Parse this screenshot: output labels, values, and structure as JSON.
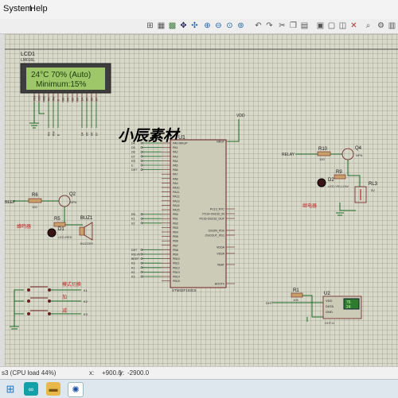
{
  "menu": {
    "items": [
      "System",
      "Help"
    ]
  },
  "toolbar": {
    "buttons": [
      "select-icon",
      "component-icon",
      "junction-icon",
      "pan-icon",
      "zoom-in-icon",
      "zoom-out-icon",
      "zoom-all-icon",
      "zoom-area-icon",
      "undo-icon",
      "redo-icon",
      "cut-icon",
      "copy-icon",
      "paste-icon",
      "block-copy-icon",
      "block-move-icon",
      "block-rotate-icon",
      "block-delete-icon"
    ]
  },
  "schematic": {
    "watermark": "小辰素材",
    "lcd": {
      "ref": "LCD1",
      "part": "LM016L",
      "line1": "24°C 70% (Auto)",
      "line2": "Minimum:15%",
      "pins": [
        "VSS",
        "VDD",
        "VEE",
        "RS",
        "RW",
        "E",
        "D0",
        "D1",
        "D2",
        "D3",
        "D4",
        "D5",
        "D6",
        "D7"
      ],
      "net_labels": [
        "RS",
        "RW",
        "E",
        "D4",
        "D5",
        "D6",
        "D7"
      ]
    },
    "mcu": {
      "ref": "U1",
      "part": "STM32F103C6",
      "left_pins": [
        "PA0-WKUP",
        "PA1",
        "PA2",
        "PA3",
        "PA4",
        "PA5",
        "PA6",
        "PA7",
        "PA8",
        "PA9",
        "PA10",
        "PA11",
        "PA12",
        "PA13",
        "PA14",
        "PA15",
        "PB0",
        "PB1",
        "PB2",
        "PB3",
        "PB4",
        "PB5",
        "PB6",
        "PB7",
        "PB8",
        "PB9",
        "PB10",
        "PB11",
        "PB12",
        "PB13",
        "PB14",
        "PB15"
      ],
      "right_pins": [
        "NRST",
        "PC13_RTC",
        "PC14-OSC32_IN",
        "PC15-OSC32_OUT",
        "OSCIN_PD0",
        "OSCOUT_PD1",
        "VDDA",
        "VSSA",
        "VBAT",
        "BOOT0"
      ],
      "left_nets": [
        "D4",
        "D5",
        "D6",
        "D7",
        "RS",
        "E",
        "DHT",
        "",
        "",
        "",
        "",
        "",
        "",
        "",
        "",
        "",
        "EN",
        "K1",
        "K2",
        "",
        "",
        "",
        "",
        "",
        "DHT",
        "RELAY",
        "BEEP",
        "K3",
        "K1",
        "K2",
        "K3",
        ""
      ],
      "vdd": "VDD"
    },
    "buzzer": {
      "title": "蜂鸣器",
      "net": "BEEP",
      "r6": "R6",
      "r6_val": "100",
      "q2": "Q2",
      "q2_type": "NPN",
      "r5": "R5",
      "d1": "D1",
      "d1_type": "LED-RED",
      "buz": "BUZ1",
      "buz_type": "BUZZER"
    },
    "relay": {
      "title": "继电器",
      "net": "RELAY",
      "r10": "R10",
      "r10_val": "100",
      "q4": "Q4",
      "q4_type": "NPN",
      "r9": "R9",
      "d2": "D2",
      "d2_type": "LED-YELLOW",
      "rl": "RL3",
      "rl_val": "5V"
    },
    "keys": {
      "k1_label": "模式切换",
      "k2_label": "加",
      "k3_label": "减",
      "nets": [
        "K1",
        "K2",
        "K3"
      ]
    },
    "dht": {
      "net": "DHT",
      "r1": "R1",
      "r1_val": "10K",
      "u2": "U2",
      "u2_type": "DHT11",
      "pins": [
        "VDD",
        "DATA",
        "GND"
      ],
      "temp": "76",
      "hum": "24"
    }
  },
  "status": {
    "left": "s3 (CPU load 44%)",
    "x_label": "x:",
    "x_value": "+900.0",
    "y_label": "y:",
    "y_value": "-2900.0"
  },
  "taskbar": {
    "icons": [
      "windows-start-icon",
      "arduino-icon",
      "folder-icon",
      "proteus-icon"
    ]
  },
  "colors": {
    "canvas": "#d9d9c9",
    "wire": "#1f6b2a",
    "pin_num": "#8a2b2b",
    "label_red": "#c42222",
    "lcd_bg": "#9ec76a",
    "lcd_text": "#1a3a0a"
  }
}
